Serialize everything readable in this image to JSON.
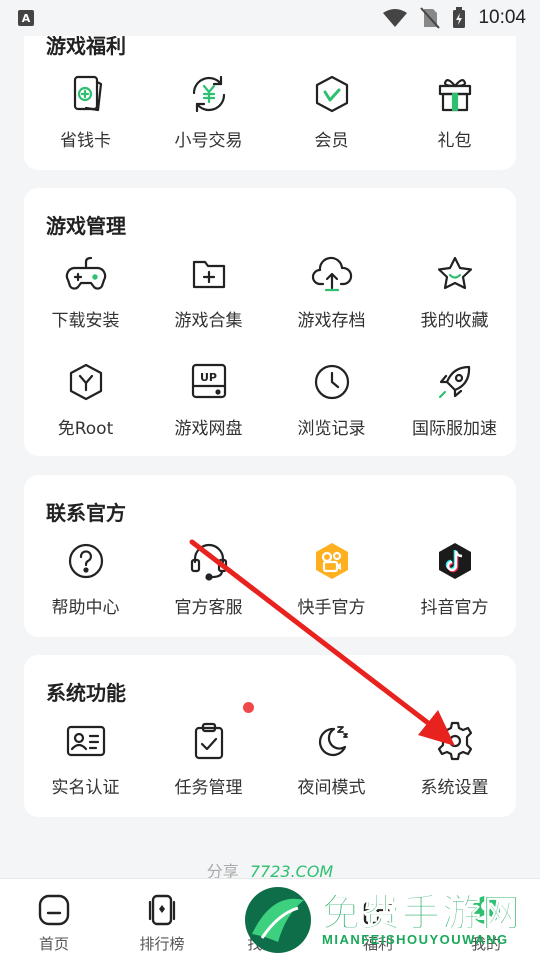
{
  "status_bar": {
    "time": "10:04",
    "notification_letter": "A"
  },
  "welfare": {
    "title": "游戏福利",
    "items": [
      {
        "label": "省钱卡",
        "icon": "savings-card-icon"
      },
      {
        "label": "小号交易",
        "icon": "yen-exchange-icon"
      },
      {
        "label": "会员",
        "icon": "vip-shield-icon"
      },
      {
        "label": "礼包",
        "icon": "gift-icon"
      }
    ]
  },
  "game_management": {
    "title": "游戏管理",
    "items": [
      {
        "label": "下载安装",
        "icon": "gamepad-icon"
      },
      {
        "label": "游戏合集",
        "icon": "folder-plus-icon"
      },
      {
        "label": "游戏存档",
        "icon": "cloud-upload-icon"
      },
      {
        "label": "我的收藏",
        "icon": "star-icon"
      },
      {
        "label": "免Root",
        "icon": "hexagon-y-icon"
      },
      {
        "label": "游戏网盘",
        "icon": "cloud-drive-icon",
        "badge": "UP"
      },
      {
        "label": "浏览记录",
        "icon": "clock-icon"
      },
      {
        "label": "国际服加速",
        "icon": "rocket-icon"
      }
    ]
  },
  "contact": {
    "title": "联系官方",
    "items": [
      {
        "label": "帮助中心",
        "icon": "help-icon"
      },
      {
        "label": "官方客服",
        "icon": "headset-icon"
      },
      {
        "label": "快手官方",
        "icon": "kuaishou-icon",
        "color": "#ffb020"
      },
      {
        "label": "抖音官方",
        "icon": "douyin-icon",
        "color": "#1b1b1b"
      }
    ]
  },
  "system": {
    "title": "系统功能",
    "items": [
      {
        "label": "实名认证",
        "icon": "id-card-icon"
      },
      {
        "label": "任务管理",
        "icon": "clipboard-check-icon"
      },
      {
        "label": "夜间模式",
        "icon": "moon-icon"
      },
      {
        "label": "系统设置",
        "icon": "settings-icon"
      }
    ]
  },
  "share": {
    "label": "分享",
    "brand": "7723.COM"
  },
  "bottom_nav": [
    {
      "label": "首页",
      "icon": "home-icon"
    },
    {
      "label": "排行榜",
      "icon": "ranking-icon"
    },
    {
      "label": "找游戏",
      "icon": "find-icon"
    },
    {
      "label": "福利",
      "icon": "welfare-icon"
    },
    {
      "label": "我的",
      "icon": "profile-icon"
    }
  ],
  "watermark": {
    "title": "免费手游网",
    "subtitle": "MIANFEISHOUYOUWANG"
  },
  "colors": {
    "accent": "#2fbf71",
    "arrow": "#e8231f",
    "dot": "#f04848",
    "watermark": "#1aa85a"
  }
}
